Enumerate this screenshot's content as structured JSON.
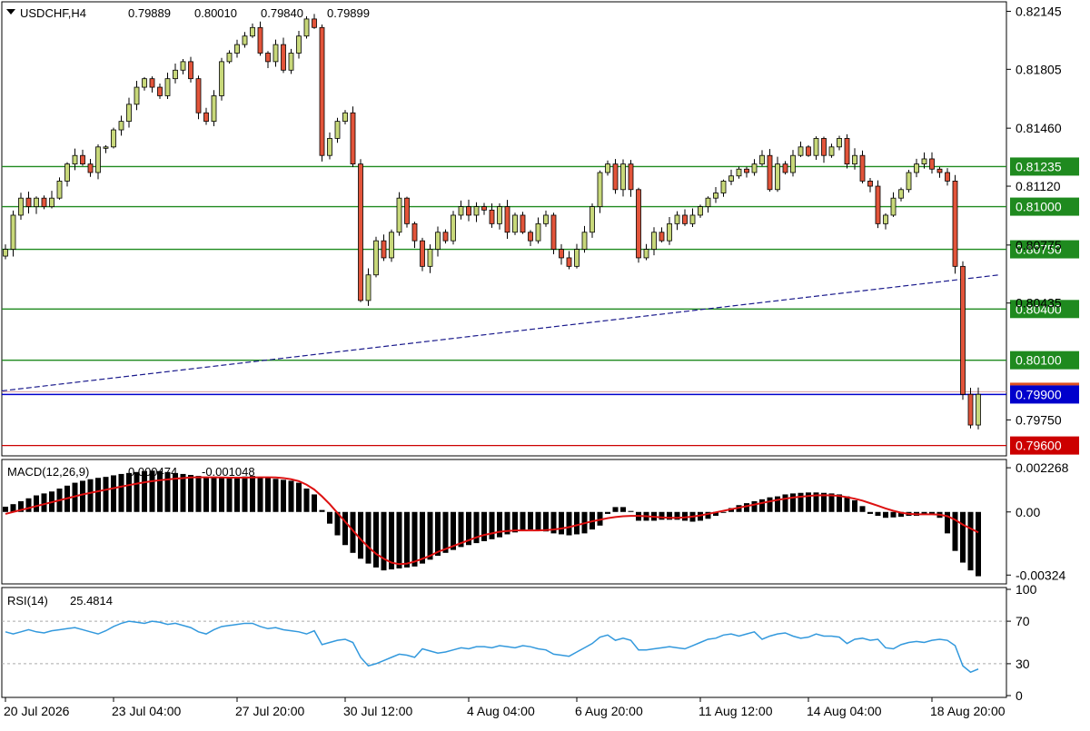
{
  "header": {
    "symbol": "USDCHF,H4",
    "open": "0.79889",
    "high": "0.80010",
    "low": "0.79840",
    "close": "0.79899"
  },
  "colors": {
    "bull_candle": "#c8d87a",
    "bear_candle": "#e2543a",
    "support_resistance": "#1f8a1f",
    "price_line": "#0000cc",
    "low_line": "#cc0000",
    "moving_average": "#1a1a8c",
    "macd_hist": "#000000",
    "macd_signal": "#dd1111",
    "rsi_line": "#3399dd",
    "rsi_levels": "#aaaaaa"
  },
  "chart_data": [
    {
      "type": "candlestick",
      "name": "price",
      "timeframe": "H4",
      "ylim": [
        0.7955,
        0.8219
      ],
      "y_ticks": [
        "0.82145",
        "0.81805",
        "0.81460",
        "0.81120",
        "0.80775",
        "0.80435",
        "0.79750"
      ],
      "x_ticks": [
        {
          "label": "20 Jul 2026",
          "index": 0
        },
        {
          "label": "23 Jul 04:00",
          "index": 14
        },
        {
          "label": "27 Jul 20:00",
          "index": 30
        },
        {
          "label": "30 Jul 12:00",
          "index": 44
        },
        {
          "label": "4 Aug 04:00",
          "index": 60
        },
        {
          "label": "6 Aug 20:00",
          "index": 74
        },
        {
          "label": "11 Aug 12:00",
          "index": 90
        },
        {
          "label": "14 Aug 04:00",
          "index": 104
        },
        {
          "label": "18 Aug 20:00",
          "index": 120
        }
      ],
      "horizontal_levels": [
        {
          "label": "0.81235",
          "value": 0.81235,
          "kind": "level"
        },
        {
          "label": "0.81000",
          "value": 0.81,
          "kind": "level"
        },
        {
          "label": "0.80750",
          "value": 0.8075,
          "kind": "level"
        },
        {
          "label": "0.80400",
          "value": 0.804,
          "kind": "level"
        },
        {
          "label": "0.80100",
          "value": 0.801,
          "kind": "level"
        },
        {
          "label": "0.79900",
          "value": 0.79899,
          "kind": "price"
        },
        {
          "label": "0.79600",
          "value": 0.796,
          "kind": "low"
        }
      ],
      "moving_average": {
        "start": 0.7992,
        "end": 0.806
      },
      "closes": [
        0.8075,
        0.8095,
        0.8105,
        0.81,
        0.8105,
        0.81,
        0.8105,
        0.8115,
        0.8125,
        0.813,
        0.8125,
        0.812,
        0.8135,
        0.8135,
        0.8145,
        0.815,
        0.816,
        0.817,
        0.8175,
        0.817,
        0.8165,
        0.8175,
        0.818,
        0.8185,
        0.8175,
        0.8155,
        0.815,
        0.8165,
        0.8185,
        0.819,
        0.8195,
        0.82,
        0.8205,
        0.819,
        0.8185,
        0.8195,
        0.818,
        0.819,
        0.82,
        0.821,
        0.8205,
        0.813,
        0.814,
        0.815,
        0.8155,
        0.8125,
        0.8045,
        0.806,
        0.808,
        0.807,
        0.8085,
        0.8105,
        0.809,
        0.808,
        0.8065,
        0.8075,
        0.8085,
        0.808,
        0.8095,
        0.81,
        0.8095,
        0.81,
        0.8098,
        0.809,
        0.81,
        0.8085,
        0.8095,
        0.8085,
        0.808,
        0.809,
        0.8095,
        0.8075,
        0.807,
        0.8065,
        0.8075,
        0.8085,
        0.81,
        0.812,
        0.8125,
        0.811,
        0.8125,
        0.811,
        0.807,
        0.8075,
        0.8085,
        0.808,
        0.809,
        0.8095,
        0.809,
        0.8095,
        0.81,
        0.8105,
        0.8108,
        0.8115,
        0.8118,
        0.8122,
        0.812,
        0.8125,
        0.813,
        0.811,
        0.8125,
        0.812,
        0.813,
        0.8135,
        0.813,
        0.814,
        0.813,
        0.8135,
        0.814,
        0.8125,
        0.813,
        0.8115,
        0.8112,
        0.809,
        0.8095,
        0.8105,
        0.811,
        0.812,
        0.8125,
        0.8128,
        0.8122,
        0.812,
        0.8115,
        0.8065,
        0.799,
        0.7972,
        0.799
      ]
    },
    {
      "type": "histogram",
      "name": "MACD(12,26,9)",
      "header_values": [
        "0.000474",
        "-0.001048"
      ],
      "y_ticks": [
        "0.002268",
        "0.00",
        "-0.00324"
      ],
      "ylim": [
        -0.0036,
        0.0026
      ],
      "hist_values": [
        0.00027,
        0.0004,
        0.00055,
        0.0007,
        0.00085,
        0.00095,
        0.00105,
        0.0012,
        0.00135,
        0.0015,
        0.0016,
        0.00168,
        0.00175,
        0.0018,
        0.00188,
        0.00195,
        0.002,
        0.00205,
        0.0021,
        0.00212,
        0.0021,
        0.00205,
        0.002,
        0.00195,
        0.0019,
        0.00185,
        0.0018,
        0.00175,
        0.00175,
        0.00178,
        0.0018,
        0.00182,
        0.00185,
        0.0018,
        0.00175,
        0.0017,
        0.00165,
        0.0016,
        0.0015,
        0.0012,
        0.0009,
        0.0001,
        -0.0006,
        -0.0012,
        -0.0017,
        -0.0021,
        -0.0024,
        -0.00265,
        -0.00285,
        -0.003,
        -0.00295,
        -0.0029,
        -0.00285,
        -0.0028,
        -0.00265,
        -0.00245,
        -0.00225,
        -0.0021,
        -0.00195,
        -0.0018,
        -0.0017,
        -0.0016,
        -0.0015,
        -0.0014,
        -0.0013,
        -0.00115,
        -0.00105,
        -0.00095,
        -0.0009,
        -0.00095,
        -0.001,
        -0.0011,
        -0.00115,
        -0.0012,
        -0.00115,
        -0.0011,
        -0.0009,
        -0.0007,
        -0.0001,
        0.00025,
        0.00025,
        5e-05,
        -0.00045,
        -0.00045,
        -0.00045,
        -0.0004,
        -0.0004,
        -0.0004,
        -0.00045,
        -0.0005,
        -0.00045,
        -0.00035,
        -0.0002,
        0.0,
        0.0002,
        0.00035,
        0.00045,
        0.00055,
        0.00065,
        0.00075,
        0.0008,
        0.0009,
        0.00095,
        0.00098,
        0.001,
        0.001,
        0.00098,
        0.00095,
        0.0009,
        0.0008,
        0.0006,
        0.0003,
        -0.0001,
        -0.0002,
        -0.0003,
        -0.00028,
        -0.00025,
        -0.0002,
        -0.0002,
        -0.00015,
        -0.0001,
        -0.0003,
        -0.0011,
        -0.002,
        -0.0026,
        -0.003,
        -0.0033
      ],
      "signal_values": [
        -0.0001,
        0.0,
        0.0001,
        0.0002,
        0.0003,
        0.0004,
        0.0005,
        0.0006,
        0.0007,
        0.0008,
        0.0009,
        0.00098,
        0.00106,
        0.00114,
        0.00122,
        0.0013,
        0.00138,
        0.00145,
        0.00152,
        0.00158,
        0.00163,
        0.00167,
        0.00171,
        0.00174,
        0.00177,
        0.00178,
        0.00178,
        0.00178,
        0.00177,
        0.00176,
        0.00176,
        0.00176,
        0.00177,
        0.00178,
        0.00178,
        0.00177,
        0.00174,
        0.00168,
        0.00158,
        0.0014,
        0.00115,
        0.0008,
        0.0004,
        -5e-05,
        -0.0005,
        -0.00095,
        -0.0014,
        -0.0018,
        -0.00215,
        -0.0024,
        -0.0026,
        -0.00268,
        -0.00265,
        -0.00255,
        -0.0024,
        -0.00225,
        -0.00205,
        -0.0019,
        -0.00175,
        -0.0016,
        -0.00145,
        -0.0013,
        -0.00118,
        -0.0011,
        -0.00102,
        -0.00098,
        -0.00095,
        -0.00095,
        -0.00095,
        -0.00095,
        -0.00093,
        -0.0009,
        -0.00085,
        -0.00078,
        -0.00068,
        -0.00058,
        -0.00048,
        -0.0004,
        -0.00032,
        -0.00026,
        -0.00022,
        -0.0002,
        -0.0002,
        -0.00022,
        -0.00025,
        -0.00028,
        -0.0003,
        -0.0003,
        -0.00028,
        -0.00024,
        -0.00018,
        -0.0001,
        -2e-05,
        6e-05,
        0.00014,
        0.00022,
        0.0003,
        0.00038,
        0.00046,
        0.00054,
        0.00062,
        0.00068,
        0.00074,
        0.00078,
        0.00082,
        0.00085,
        0.00086,
        0.00085,
        0.00082,
        0.00076,
        0.00068,
        0.00058,
        0.00045,
        0.00032,
        0.00018,
        6e-05,
        -4e-05,
        -0.0001,
        -0.00012,
        -0.00012,
        -0.00012,
        -0.00014,
        -0.00022,
        -0.0004,
        -0.00065,
        -0.00085,
        -0.00105
      ]
    },
    {
      "type": "line",
      "name": "RSI(14)",
      "header_value": "25.4814",
      "y_ticks": [
        "100",
        "70",
        "30",
        "0"
      ],
      "ylim": [
        0,
        100
      ],
      "levels": [
        70,
        30
      ],
      "values": [
        60,
        58,
        60,
        62,
        60,
        59,
        61,
        62,
        63,
        64,
        62,
        60,
        58,
        61,
        65,
        68,
        70,
        69,
        68,
        70,
        69,
        67,
        68,
        66,
        64,
        60,
        58,
        62,
        65,
        66,
        67,
        68,
        68,
        65,
        63,
        64,
        62,
        61,
        60,
        58,
        61,
        48,
        50,
        52,
        53,
        50,
        36,
        28,
        30,
        33,
        36,
        39,
        38,
        36,
        44,
        42,
        40,
        41,
        43,
        45,
        44,
        46,
        46,
        45,
        47,
        46,
        45,
        47,
        46,
        44,
        43,
        39,
        38,
        37,
        41,
        45,
        49,
        55,
        57,
        52,
        54,
        52,
        43,
        43,
        44,
        45,
        46,
        45,
        44,
        47,
        50,
        53,
        54,
        57,
        58,
        56,
        58,
        60,
        53,
        56,
        58,
        59,
        56,
        54,
        55,
        58,
        56,
        56,
        55,
        49,
        53,
        54,
        52,
        53,
        45,
        44,
        48,
        50,
        51,
        50,
        52,
        53,
        52,
        47,
        28,
        22,
        25
      ]
    }
  ]
}
